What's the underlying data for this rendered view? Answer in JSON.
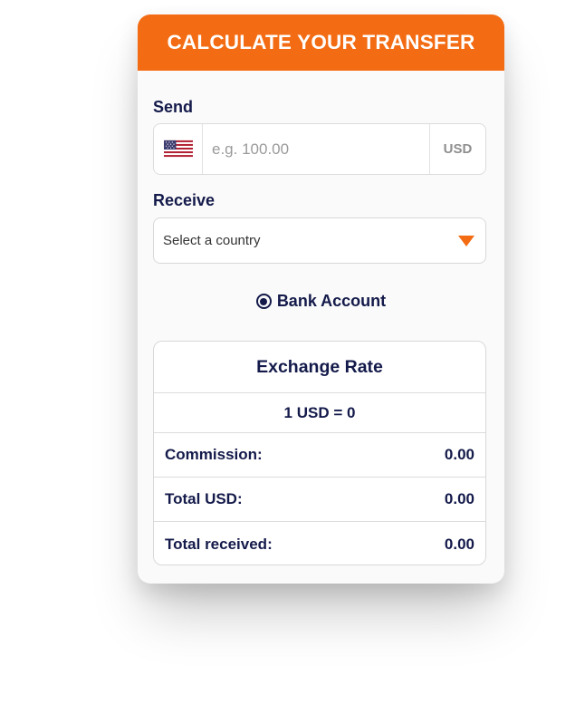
{
  "header": {
    "title": "CALCULATE YOUR TRANSFER"
  },
  "send": {
    "label": "Send",
    "flag_icon": "us-flag-icon",
    "placeholder": "e.g. 100.00",
    "value": "",
    "currency": "USD"
  },
  "receive": {
    "label": "Receive",
    "select_text": "Select a country",
    "dropdown_icon": "triangle-down-icon"
  },
  "delivery": {
    "option_label": "Bank Account",
    "selected": true
  },
  "rates": {
    "title": "Exchange Rate",
    "rate_text": "1 USD = 0",
    "rows": [
      {
        "label": "Commission:",
        "value": "0.00"
      },
      {
        "label": "Total USD:",
        "value": "0.00"
      },
      {
        "label": "Total received:",
        "value": "0.00"
      }
    ]
  },
  "colors": {
    "accent": "#f36b12",
    "text_dark": "#141a4a",
    "card_bg": "#fafafa"
  }
}
